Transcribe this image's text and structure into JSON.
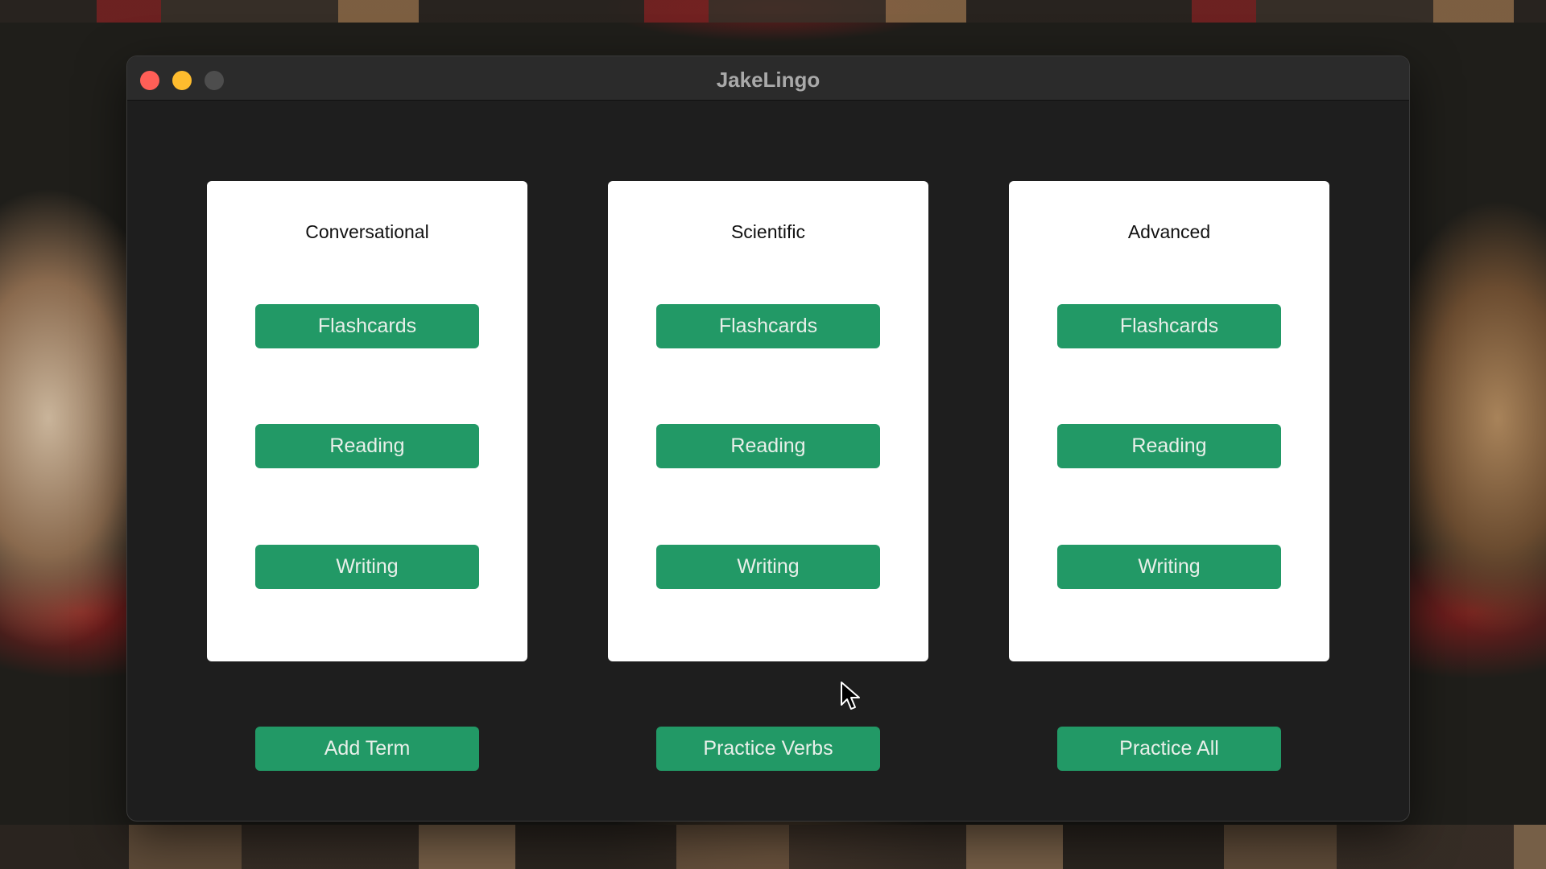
{
  "window": {
    "title": "JakeLingo"
  },
  "cards": [
    {
      "title": "Conversational",
      "buttons": [
        "Flashcards",
        "Reading",
        "Writing"
      ]
    },
    {
      "title": "Scientific",
      "buttons": [
        "Flashcards",
        "Reading",
        "Writing"
      ]
    },
    {
      "title": "Advanced",
      "buttons": [
        "Flashcards",
        "Reading",
        "Writing"
      ]
    }
  ],
  "actions": {
    "add_term": "Add Term",
    "practice_verbs": "Practice Verbs",
    "practice_all": "Practice All"
  },
  "colors": {
    "accent_green": "#229966",
    "window_bg": "#1e1e1e",
    "card_bg": "#ffffff",
    "close": "#ff5f57",
    "minimize": "#febc2e",
    "zoom_inactive": "#4d4d4d"
  }
}
